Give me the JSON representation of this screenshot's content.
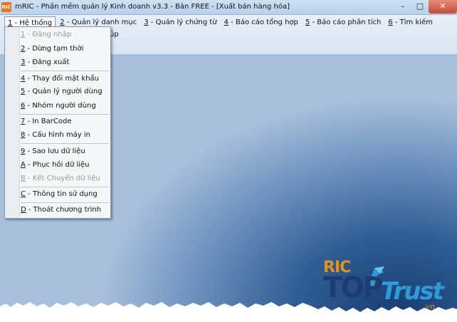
{
  "window": {
    "icon_text": "RIC",
    "title": "mRIC - Phần mềm quản lý Kinh doanh v3.3 - Bản FREE - [Xuất bán hàng hóa]",
    "minimize": "–",
    "maximize": "□",
    "close": "✕"
  },
  "menubar": {
    "items": [
      {
        "key": "1",
        "label": " - Hệ thống"
      },
      {
        "key": "2",
        "label": " - Quản lý danh mục"
      },
      {
        "key": "3",
        "label": " - Quản lý chứng từ"
      },
      {
        "key": "4",
        "label": " - Báo cáo tổng hợp"
      },
      {
        "key": "5",
        "label": " - Báo cáo phân tích"
      },
      {
        "key": "6",
        "label": " - Tìm kiếm"
      }
    ],
    "overflow_fragment": "úp"
  },
  "dropdown": {
    "items": [
      {
        "key": "1",
        "label": " - Đăng nhập",
        "disabled": true
      },
      {
        "key": "2",
        "label": " - Dừng tạm thời"
      },
      {
        "key": "3",
        "label": " - Đăng xuất"
      },
      {
        "key": "4",
        "label": " - Thay đổi mật khẩu"
      },
      {
        "key": "5",
        "label": " - Quản lý người dùng"
      },
      {
        "key": "6",
        "label": " - Nhóm người dùng"
      },
      {
        "key": "7",
        "label": " - In BarCode"
      },
      {
        "key": "8",
        "label": " - Cấu hình máy in"
      },
      {
        "key": "9",
        "label": " - Sao lưu dữ liệu"
      },
      {
        "key": "A",
        "label": " - Phục hồi dữ liệu"
      },
      {
        "key": "B",
        "label": " - Kết Chuyển dữ liệu",
        "disabled": true
      },
      {
        "key": "C",
        "label": " - Thông tin sử dụng"
      },
      {
        "key": "D",
        "label": " - Thoát chương trình"
      }
    ]
  },
  "watermark": {
    "brand": "RIC",
    "word1": "TOP",
    "word2": "Trust",
    "suffix": ".vn"
  },
  "colors": {
    "brand_orange": "#e1921d",
    "brand_navy": "#1f3c72",
    "brand_blue": "#2f9bd6"
  }
}
